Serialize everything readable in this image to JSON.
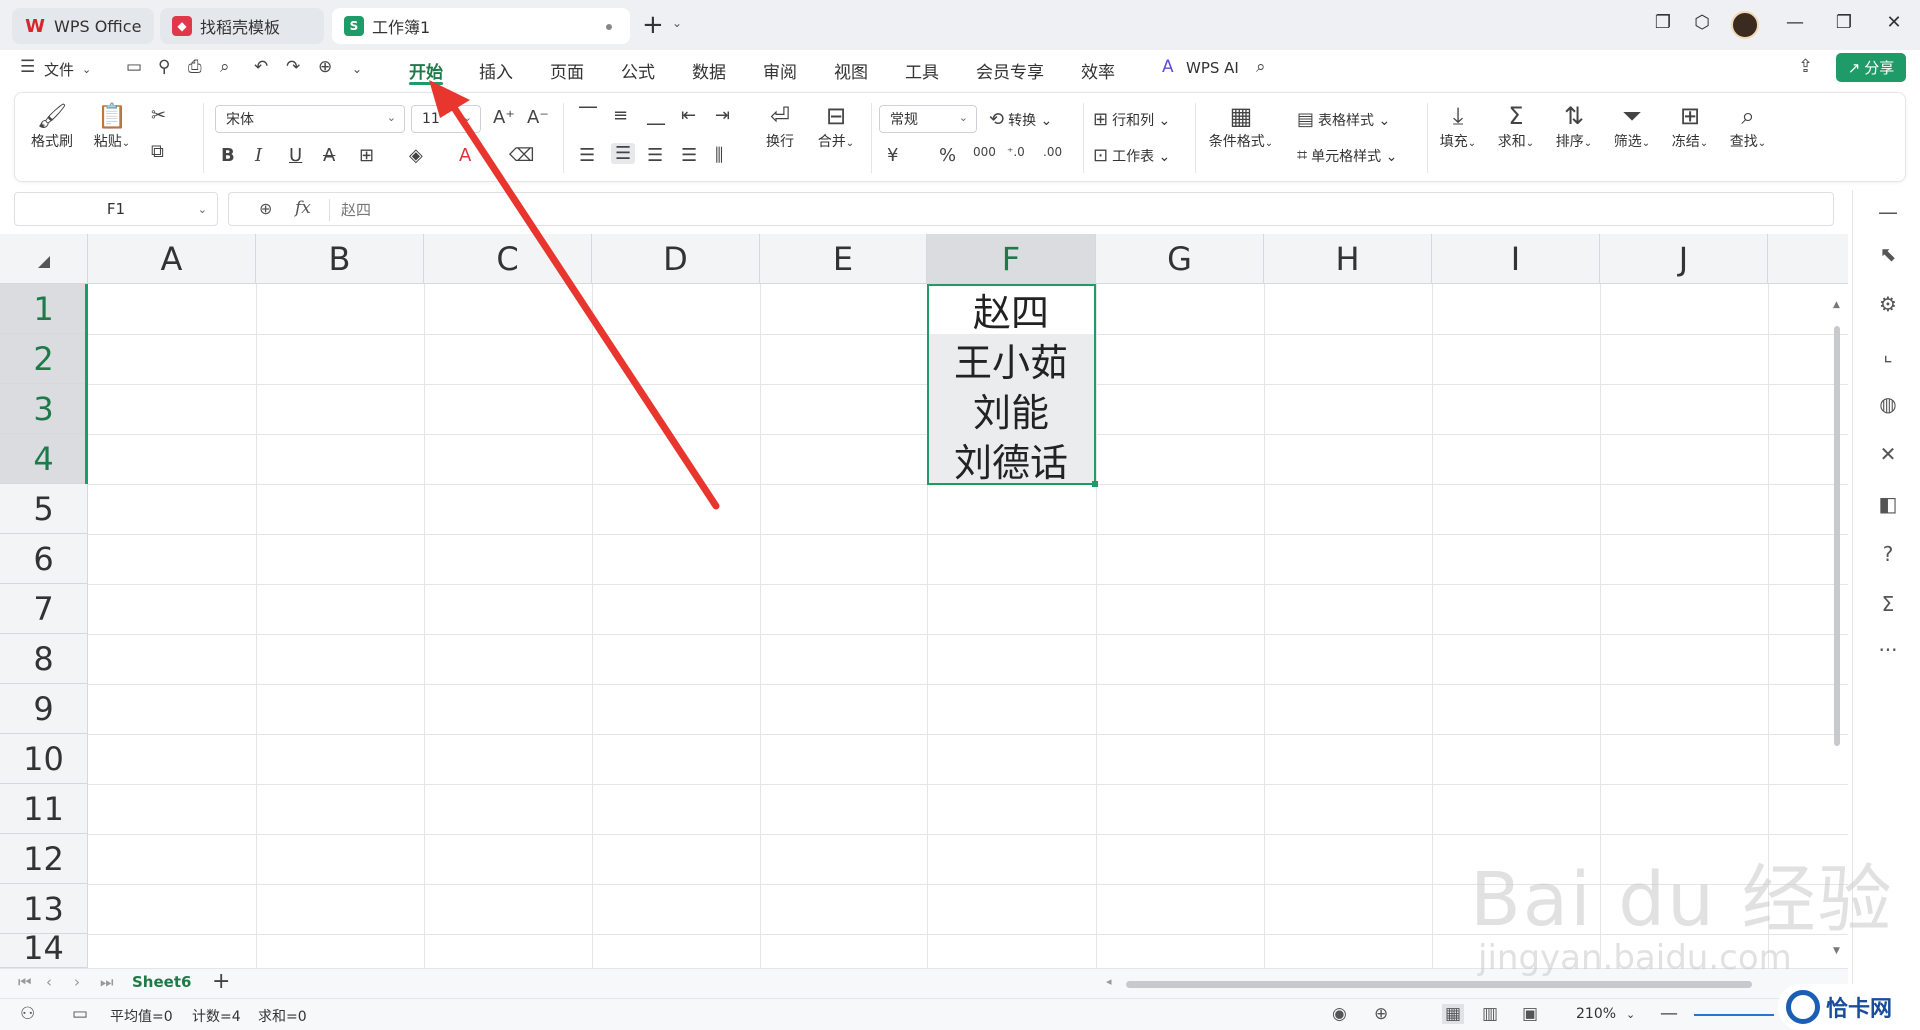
{
  "tabs": {
    "wps": "WPS Office",
    "template": "找稻壳模板",
    "book": "工作簿1"
  },
  "menu": {
    "file": "文件",
    "items": [
      "开始",
      "插入",
      "页面",
      "公式",
      "数据",
      "审阅",
      "视图",
      "工具",
      "会员专享",
      "效率"
    ],
    "wps_ai": "WPS AI",
    "share": "分享"
  },
  "ribbon": {
    "format_painter": "格式刷",
    "paste": "粘贴",
    "font_name": "宋体",
    "font_size": "11",
    "wrap": "换行",
    "merge": "合并",
    "number_format": "常规",
    "convert": "转换",
    "rows_cols": "行和列",
    "worksheet": "工作表",
    "cond_format": "条件格式",
    "table_style": "表格样式",
    "cell_style": "单元格样式",
    "fill": "填充",
    "sum": "求和",
    "sort": "排序",
    "filter": "筛选",
    "freeze": "冻结",
    "find": "查找"
  },
  "formula_bar": {
    "name_box": "F1",
    "fx": "fx",
    "value": "赵四"
  },
  "grid": {
    "columns": [
      "A",
      "B",
      "C",
      "D",
      "E",
      "F",
      "G",
      "H",
      "I",
      "J"
    ],
    "rows": [
      "1",
      "2",
      "3",
      "4",
      "5",
      "6",
      "7",
      "8",
      "9",
      "10",
      "11",
      "12",
      "13",
      "14"
    ],
    "selected_column": "F",
    "cells_F": [
      "赵四",
      "王小茹",
      "刘能",
      "刘德话"
    ]
  },
  "sheets": {
    "active": "Sheet6"
  },
  "status": {
    "average": "平均值=0",
    "count": "计数=4",
    "sum": "求和=0",
    "zoom": "210%"
  },
  "watermarks": {
    "baidu": "Bai du 经验",
    "jingyan": "jingyan.baidu.com",
    "qiakawang": "恰卡网"
  },
  "colors": {
    "accent": "#1f9b67",
    "arrow": "#e8352e"
  }
}
